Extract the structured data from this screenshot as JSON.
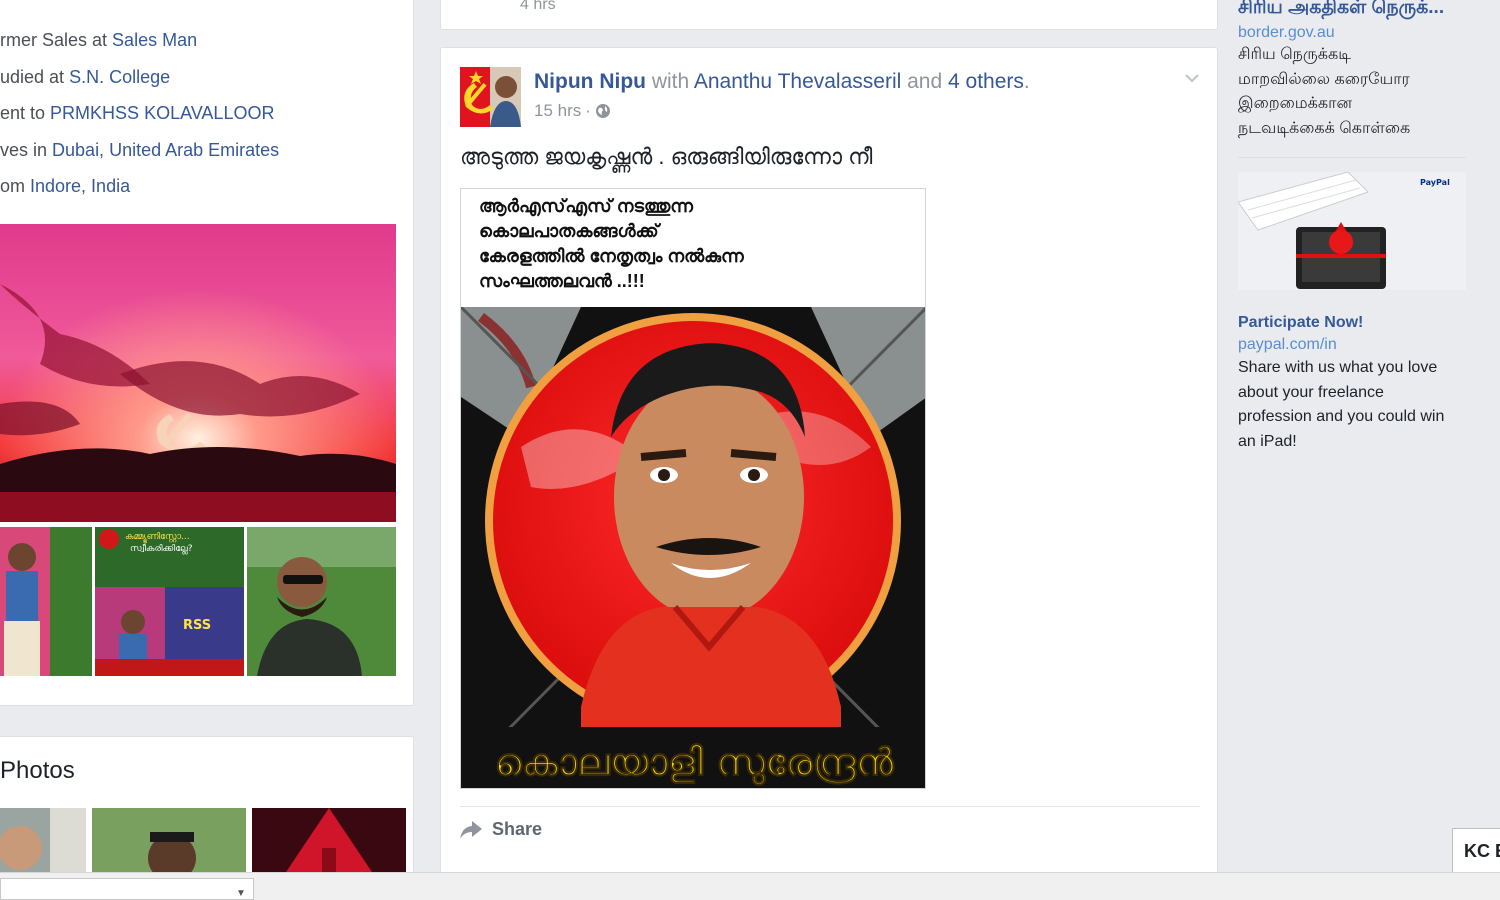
{
  "intro": {
    "items": [
      {
        "prefix": "rmer Sales at ",
        "link": "Sales Man"
      },
      {
        "prefix": "udied at ",
        "link": "S.N. College"
      },
      {
        "prefix": "ent to ",
        "link": "PRMKHSS KOLAVALLOOR"
      },
      {
        "prefix": "ves in ",
        "link": "Dubai, United Arab Emirates"
      },
      {
        "prefix": "om ",
        "link": "Indore, India"
      }
    ]
  },
  "thumbs": {
    "poster_line1": "കമ്മ്യൂണിസ്റ്റോ...",
    "poster_line2": "സ്വീകരിക്കില്ലേ?",
    "poster_rss": "RSS"
  },
  "photos": {
    "title": "Photos"
  },
  "previous_post": {
    "time": "4 hrs"
  },
  "post": {
    "author": "Nipun Nipu",
    "with_word": "with",
    "tagged": "Ananthu Thevalasseril",
    "and_word": "and",
    "others": "4 others",
    "period": ".",
    "time": "15 hrs",
    "separator": "·",
    "text": "അടുത്ത ജയകൃഷ്ണൻ . ഒരുങ്ങിയിരുന്നോ നീ",
    "image_caption": [
      "ആർഎസ്എസ് നടത്തുന്ന",
      "കൊലപാതകങ്ങൾക്ക്",
      "കേരളത്തിൽ നേതൃത്വം നൽകുന്ന",
      "സംഘത്തലവൻ ..!!!"
    ],
    "image_banner": "കൊലയാളി സുരേന്ദ്രൻ",
    "share_label": "Share"
  },
  "ads": [
    {
      "title": "சிரிய அகதிகள் நெருக்...",
      "domain": "border.gov.au",
      "body": [
        "சிரிய நெருக்கடி",
        "மாறவில்லை கரையோர",
        "இறைமைக்கான",
        "நடவடிக்கைக் கொள்கை"
      ]
    },
    {
      "title": "Participate Now!",
      "domain": "paypal.com/in",
      "body": [
        "Share with us what you love",
        "about your freelance",
        "profession and you could win",
        "an iPad!"
      ],
      "image_brand": "PayPal"
    }
  ],
  "chat": {
    "label": "KC E"
  },
  "colors": {
    "link": "#365899",
    "background": "#e9ebee",
    "banner_text": "#f5d90a"
  }
}
